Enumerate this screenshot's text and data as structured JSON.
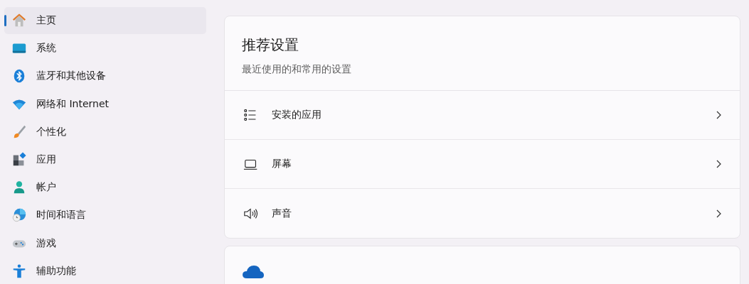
{
  "sidebar": {
    "items": [
      {
        "label": "主页",
        "selected": true
      },
      {
        "label": "系统",
        "selected": false
      },
      {
        "label": "蓝牙和其他设备",
        "selected": false
      },
      {
        "label": "网络和 Internet",
        "selected": false
      },
      {
        "label": "个性化",
        "selected": false
      },
      {
        "label": "应用",
        "selected": false
      },
      {
        "label": "帐户",
        "selected": false
      },
      {
        "label": "时间和语言",
        "selected": false
      },
      {
        "label": "游戏",
        "selected": false
      },
      {
        "label": "辅助功能",
        "selected": false
      }
    ]
  },
  "recommended": {
    "title": "推荐设置",
    "subtitle": "最近使用的和常用的设置",
    "rows": [
      {
        "label": "安装的应用"
      },
      {
        "label": "屏幕"
      },
      {
        "label": "声音"
      }
    ]
  }
}
